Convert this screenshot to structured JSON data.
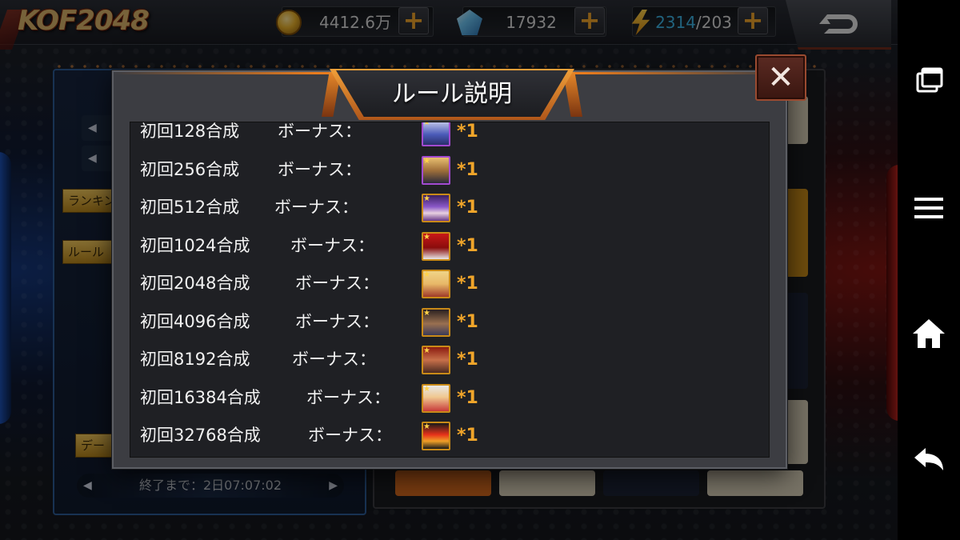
{
  "app": {
    "logo": "KOF2048"
  },
  "resources": {
    "coins": {
      "icon": "gold-coin-icon",
      "value": "4412.6万"
    },
    "gems": {
      "icon": "blue-gem-icon",
      "value": "17932"
    },
    "stamina": {
      "icon": "lightning-icon",
      "current": "2314",
      "separator": "/",
      "max": "203"
    },
    "plus_label": "+"
  },
  "background_panel": {
    "buttons": [
      "ランキング",
      "ルール",
      "デー"
    ],
    "timer_text": "終了まで：2日07:07:02"
  },
  "modal": {
    "title": "ルール説明",
    "close_label": "✕",
    "rows": [
      {
        "label": "初回128合成",
        "bonus": "ボーナス：",
        "qty": "*1",
        "avatar": "character-avatar-icon",
        "rarity": "purple"
      },
      {
        "label": "初回256合成",
        "bonus": "ボーナス：",
        "qty": "*1",
        "avatar": "character-avatar-icon",
        "rarity": "purple"
      },
      {
        "label": "初回512合成",
        "bonus": "ボーナス：",
        "qty": "*1",
        "avatar": "character-avatar-icon",
        "rarity": "gold"
      },
      {
        "label": "初回1024合成",
        "bonus": "ボーナス：",
        "qty": "*1",
        "avatar": "character-avatar-icon",
        "rarity": "gold"
      },
      {
        "label": "初回2048合成",
        "bonus": "ボーナス：",
        "qty": "*1",
        "avatar": "character-avatar-icon",
        "rarity": "gold"
      },
      {
        "label": "初回4096合成",
        "bonus": "ボーナス：",
        "qty": "*1",
        "avatar": "character-avatar-icon",
        "rarity": "gold"
      },
      {
        "label": "初回8192合成",
        "bonus": "ボーナス：",
        "qty": "*1",
        "avatar": "character-avatar-icon",
        "rarity": "gold"
      },
      {
        "label": "初回16384合成",
        "bonus": "ボーナス：",
        "qty": "*1",
        "avatar": "character-avatar-icon",
        "rarity": "gold"
      },
      {
        "label": "初回32768合成",
        "bonus": "ボーナス：",
        "qty": "*1",
        "avatar": "fire-item-icon",
        "rarity": "gold"
      }
    ]
  },
  "colors": {
    "accent_orange": "#f0a52a",
    "stamina_blue": "#3db4e6",
    "modal_bg": "#1f2024"
  },
  "system_nav": {
    "buttons": [
      "recent-apps-icon",
      "menu-icon",
      "home-icon",
      "back-icon"
    ]
  }
}
